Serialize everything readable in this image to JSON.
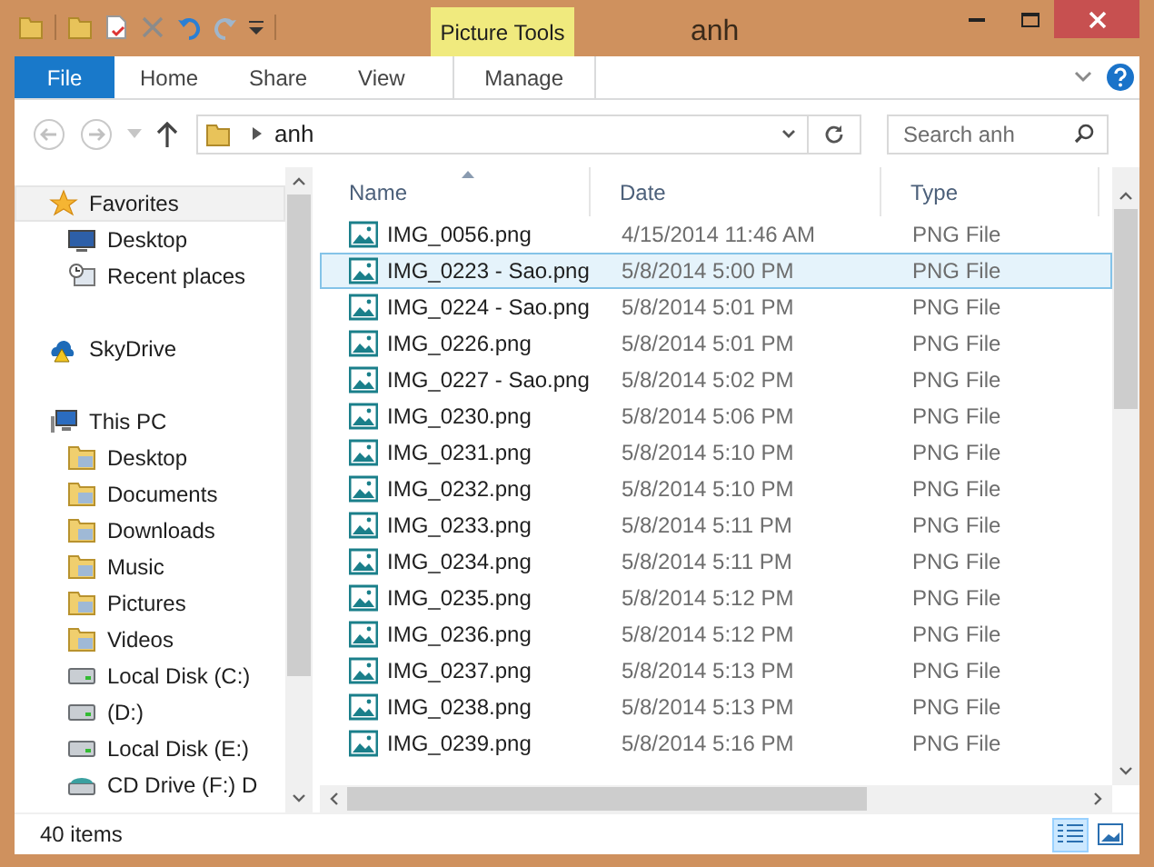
{
  "window": {
    "title": "anh",
    "contextual_tab_group": "Picture Tools"
  },
  "ribbon_tabs": [
    {
      "label": "File",
      "kind": "file",
      "selected": false
    },
    {
      "label": "Home",
      "kind": "tab",
      "selected": false
    },
    {
      "label": "Share",
      "kind": "tab",
      "selected": false
    },
    {
      "label": "View",
      "kind": "tab",
      "selected": false
    },
    {
      "label": "Manage",
      "kind": "contextual",
      "selected": false
    }
  ],
  "address_bar": {
    "path": "anh"
  },
  "search": {
    "placeholder": "Search anh"
  },
  "sidebar": {
    "items": [
      {
        "label": "Favorites",
        "kind": "star",
        "selected": true,
        "children": [
          {
            "label": "Desktop",
            "kind": "desktop",
            "selected": false
          },
          {
            "label": "Recent places",
            "kind": "recent",
            "selected": false
          }
        ]
      },
      {
        "label": "SkyDrive",
        "kind": "cloud",
        "selected": false
      },
      {
        "label": "This PC",
        "kind": "pc",
        "selected": false,
        "children": [
          {
            "label": "Desktop",
            "kind": "folder",
            "selected": false
          },
          {
            "label": "Documents",
            "kind": "folder",
            "selected": false
          },
          {
            "label": "Downloads",
            "kind": "folder",
            "selected": false
          },
          {
            "label": "Music",
            "kind": "folder",
            "selected": false
          },
          {
            "label": "Pictures",
            "kind": "folder",
            "selected": false
          },
          {
            "label": "Videos",
            "kind": "folder",
            "selected": false
          },
          {
            "label": "Local Disk (C:)",
            "kind": "drive",
            "selected": false
          },
          {
            "label": "(D:)",
            "kind": "drive",
            "selected": false
          },
          {
            "label": "Local Disk (E:)",
            "kind": "drive",
            "selected": false
          },
          {
            "label": "CD Drive (F:) D",
            "kind": "cd",
            "selected": false
          }
        ]
      }
    ]
  },
  "file_list": {
    "columns": [
      {
        "label": "Name",
        "sorted": true
      },
      {
        "label": "Date",
        "sorted": false
      },
      {
        "label": "Type",
        "sorted": false
      }
    ],
    "rows": [
      {
        "name": "IMG_0056.png",
        "date": "4/15/2014 11:46 AM",
        "type": "PNG File",
        "selected": false
      },
      {
        "name": "IMG_0223 - Sao.png",
        "date": "5/8/2014 5:00 PM",
        "type": "PNG File",
        "selected": true
      },
      {
        "name": "IMG_0224 - Sao.png",
        "date": "5/8/2014 5:01 PM",
        "type": "PNG File",
        "selected": false
      },
      {
        "name": "IMG_0226.png",
        "date": "5/8/2014 5:01 PM",
        "type": "PNG File",
        "selected": false
      },
      {
        "name": "IMG_0227 - Sao.png",
        "date": "5/8/2014 5:02 PM",
        "type": "PNG File",
        "selected": false
      },
      {
        "name": "IMG_0230.png",
        "date": "5/8/2014 5:06 PM",
        "type": "PNG File",
        "selected": false
      },
      {
        "name": "IMG_0231.png",
        "date": "5/8/2014 5:10 PM",
        "type": "PNG File",
        "selected": false
      },
      {
        "name": "IMG_0232.png",
        "date": "5/8/2014 5:10 PM",
        "type": "PNG File",
        "selected": false
      },
      {
        "name": "IMG_0233.png",
        "date": "5/8/2014 5:11 PM",
        "type": "PNG File",
        "selected": false
      },
      {
        "name": "IMG_0234.png",
        "date": "5/8/2014 5:11 PM",
        "type": "PNG File",
        "selected": false
      },
      {
        "name": "IMG_0235.png",
        "date": "5/8/2014 5:12 PM",
        "type": "PNG File",
        "selected": false
      },
      {
        "name": "IMG_0236.png",
        "date": "5/8/2014 5:12 PM",
        "type": "PNG File",
        "selected": false
      },
      {
        "name": "IMG_0237.png",
        "date": "5/8/2014 5:13 PM",
        "type": "PNG File",
        "selected": false
      },
      {
        "name": "IMG_0238.png",
        "date": "5/8/2014 5:13 PM",
        "type": "PNG File",
        "selected": false
      },
      {
        "name": "IMG_0239.png",
        "date": "5/8/2014 5:16 PM",
        "type": "PNG File",
        "selected": false
      }
    ]
  },
  "status_bar": {
    "count": "40 items",
    "view_buttons": [
      {
        "kind": "details",
        "selected": true
      },
      {
        "kind": "large_icons",
        "selected": false
      }
    ]
  }
}
